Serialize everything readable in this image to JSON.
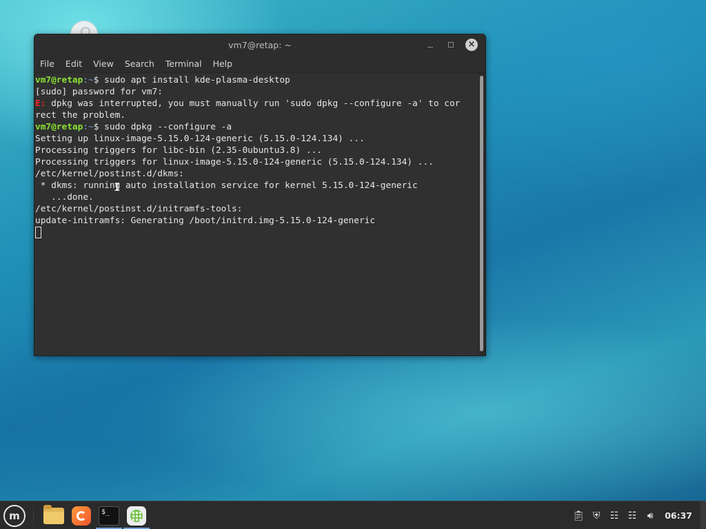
{
  "window": {
    "title": "vm7@retap: ~",
    "menu": [
      "File",
      "Edit",
      "View",
      "Search",
      "Terminal",
      "Help"
    ]
  },
  "terminal": {
    "lines": [
      {
        "user": "vm7@retap",
        "path": ":~",
        "cmd": "$ sudo apt install kde-plasma-desktop"
      },
      {
        "text": "[sudo] password for vm7:"
      },
      {
        "err": "E:",
        "text": " dpkg was interrupted, you must manually run 'sudo dpkg --configure -a' to cor"
      },
      {
        "text": "rect the problem."
      },
      {
        "user": "vm7@retap",
        "path": ":~",
        "cmd": "$ sudo dpkg --configure -a"
      },
      {
        "text": "Setting up linux-image-5.15.0-124-generic (5.15.0-124.134) ..."
      },
      {
        "text": "Processing triggers for libc-bin (2.35-0ubuntu3.8) ..."
      },
      {
        "text": "Processing triggers for linux-image-5.15.0-124-generic (5.15.0-124.134) ..."
      },
      {
        "text": "/etc/kernel/postinst.d/dkms:"
      },
      {
        "text": " * dkms: running auto installation service for kernel 5.15.0-124-generic"
      },
      {
        "text": "   ...done."
      },
      {
        "text": "/etc/kernel/postinst.d/initramfs-tools:"
      },
      {
        "text": "update-initramfs: Generating /boot/initrd.img-5.15.0-124-generic"
      }
    ]
  },
  "taskbar": {
    "menu_glyph": "m",
    "launchers": [
      "files-icon",
      "firefox-icon",
      "terminal-icon",
      "apps-icon"
    ],
    "terminal_glyph": "$_",
    "tray_icons": [
      "clipboard-icon",
      "shield-icon",
      "notes-icon",
      "network-icon",
      "volume-icon"
    ],
    "clock": "06:37"
  }
}
